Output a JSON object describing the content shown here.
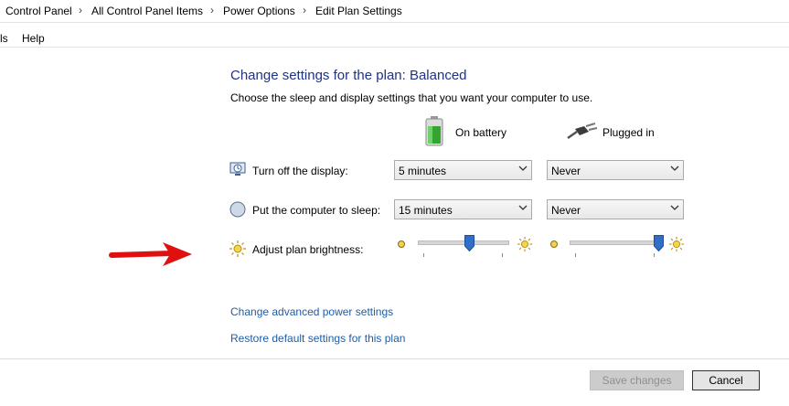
{
  "breadcrumb": {
    "items": [
      "Control Panel",
      "All Control Panel Items",
      "Power Options",
      "Edit Plan Settings"
    ],
    "separator": "›"
  },
  "menu": {
    "items": [
      "ls",
      "Help"
    ]
  },
  "page": {
    "title": "Change settings for the plan: Balanced",
    "description": "Choose the sleep and display settings that you want your computer to use."
  },
  "columns": {
    "battery": "On battery",
    "plugged": "Plugged in"
  },
  "rows": {
    "display": {
      "label": "Turn off the display:",
      "battery": "5 minutes",
      "plugged": "Never"
    },
    "sleep": {
      "label": "Put the computer to sleep:",
      "battery": "15 minutes",
      "plugged": "Never"
    },
    "brightness": {
      "label": "Adjust plan brightness:",
      "battery_level": 0.58,
      "plugged_level": 0.99
    }
  },
  "links": {
    "advanced": "Change advanced power settings",
    "restore": "Restore default settings for this plan"
  },
  "buttons": {
    "save": "Save changes",
    "cancel": "Cancel"
  },
  "colors": {
    "title": "#1e3287",
    "link": "#1f5da6",
    "slider_thumb": "#2f6fc8",
    "arrow": "#e01010",
    "battery_green": "#35a532"
  }
}
